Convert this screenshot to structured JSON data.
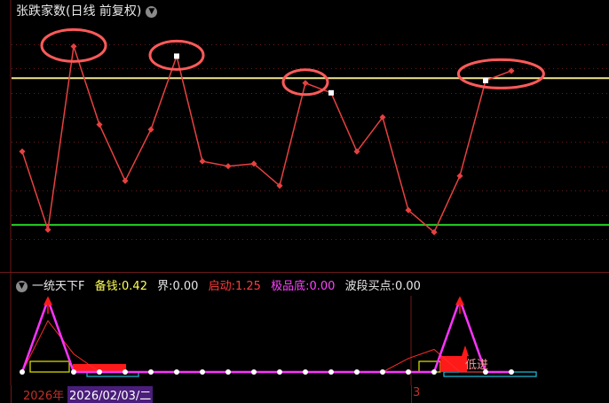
{
  "main_panel": {
    "title": "张跌家数(日线 前复权)",
    "settings_icon": "chevron-down-icon",
    "colors": {
      "upper_line": "#f0e68c",
      "lower_line": "#22d022",
      "series": "#e84040",
      "highlight": "#ff5a5a",
      "grid": "#6b1a1a"
    },
    "chart_data": {
      "type": "line",
      "title": "张跌家数(日线 前复权)",
      "x_index": [
        0,
        1,
        2,
        3,
        4,
        5,
        6,
        7,
        8,
        9,
        10,
        11,
        12,
        13,
        14,
        15,
        16,
        17,
        18,
        19
      ],
      "values": [
        4.6,
        1.4,
        8.9,
        5.7,
        3.4,
        5.5,
        8.5,
        4.2,
        4.0,
        4.1,
        3.2,
        7.4,
        7.0,
        4.6,
        6.0,
        2.2,
        1.3,
        3.6,
        7.5,
        7.9
      ],
      "reference_lines": [
        {
          "value": 7.6,
          "color": "#f0e68c"
        },
        {
          "value": 1.6,
          "color": "#22d022"
        }
      ],
      "highlighted_points": [
        6,
        12,
        18
      ],
      "circled_points": [
        2,
        6,
        11,
        18,
        19
      ]
    }
  },
  "indicator_panel": {
    "name": "一统天下F",
    "settings_icon": "chevron-down-icon",
    "items": [
      {
        "label": "备钱:",
        "value": "0.42",
        "color": "#ffff55"
      },
      {
        "label": "界:",
        "value": "0.00",
        "color": "#e8e8e8"
      },
      {
        "label": "启动:",
        "value": "1.25",
        "color": "#ff3b3b"
      },
      {
        "label": "极品底:",
        "value": "0.00",
        "color": "#ff44ff"
      },
      {
        "label": "波段买点:",
        "value": "0.00",
        "color": "#e8e8e8"
      }
    ],
    "chart_data": {
      "type": "line",
      "x_index": [
        0,
        1,
        2,
        3,
        4,
        5,
        6,
        7,
        8,
        9,
        10,
        11,
        12,
        13,
        14,
        15,
        16,
        17,
        18,
        19
      ],
      "series": [
        {
          "name": "极品底",
          "values": [
            0,
            9.6,
            0,
            0,
            0,
            0,
            0,
            0,
            0,
            0,
            0,
            0,
            0,
            0,
            0,
            0,
            0,
            9.6,
            0,
            0
          ]
        },
        {
          "name": "启动",
          "values": [
            0,
            6.8,
            2.4,
            0,
            0,
            0,
            0,
            0,
            0,
            0,
            0,
            0,
            0,
            0,
            0,
            1.8,
            3.0,
            0,
            0,
            0
          ]
        }
      ],
      "annotation": "低进"
    }
  },
  "date_axis": {
    "year_label": "2026年",
    "selected_date": "2026/02/03/二",
    "month_label": "3"
  }
}
